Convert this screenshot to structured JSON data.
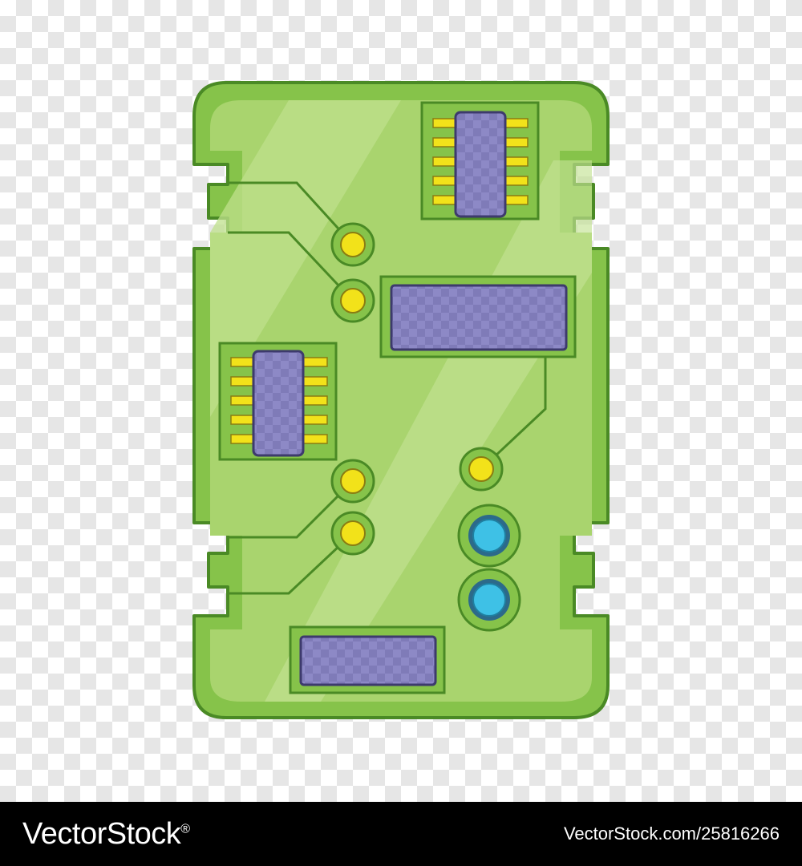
{
  "image": {
    "subject": "circuit-board-icon",
    "colors": {
      "board": "#86c34a",
      "board_light": "#b4d97c",
      "outline": "#4a8a25",
      "chip": "#7f7bb8",
      "pin": "#f2e21a",
      "pad": "#f2e21a",
      "led": "#3ec1e6"
    }
  },
  "footer": {
    "brand_left": "VectorStock",
    "brand_mark": "®",
    "image_id": "VectorStock.com/25816266"
  }
}
